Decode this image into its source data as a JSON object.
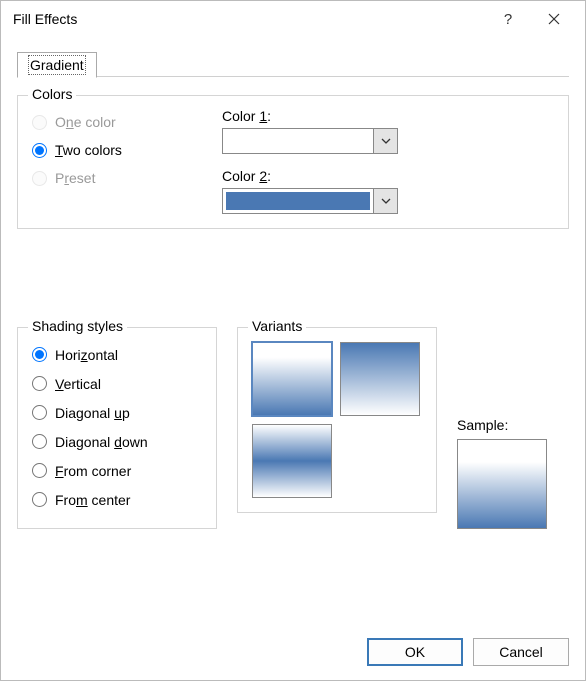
{
  "title": "Fill Effects",
  "tab": "Gradient",
  "colors_group": {
    "label": "Colors",
    "options": {
      "one": {
        "pre": "O",
        "u": "n",
        "post": "e color"
      },
      "two": {
        "pre": "",
        "u": "T",
        "post": "wo colors"
      },
      "preset": {
        "pre": "P",
        "u": "r",
        "post": "eset"
      }
    },
    "color1": {
      "pre": "Color ",
      "u": "1",
      "post": ":"
    },
    "color2": {
      "pre": "Color ",
      "u": "2",
      "post": ":"
    },
    "color1_value": "#FFFFFF",
    "color2_value": "#4A78B3",
    "selected": "two"
  },
  "shading": {
    "label": "Shading styles",
    "options": {
      "horizontal": {
        "pre": "Hori",
        "u": "z",
        "post": "ontal"
      },
      "vertical": {
        "pre": "",
        "u": "V",
        "post": "ertical"
      },
      "diagonal_up": {
        "pre": "Diagonal ",
        "u": "u",
        "post": "p"
      },
      "diagonal_down": {
        "pre": "Diagonal ",
        "u": "d",
        "post": "own"
      },
      "from_corner": {
        "pre": "",
        "u": "F",
        "post": "rom corner"
      },
      "from_center": {
        "pre": "Fro",
        "u": "m",
        "post": " center"
      }
    },
    "selected": "horizontal"
  },
  "variants_label": "Variants",
  "sample_label": "Sample:",
  "buttons": {
    "ok": "OK",
    "cancel": "Cancel"
  }
}
